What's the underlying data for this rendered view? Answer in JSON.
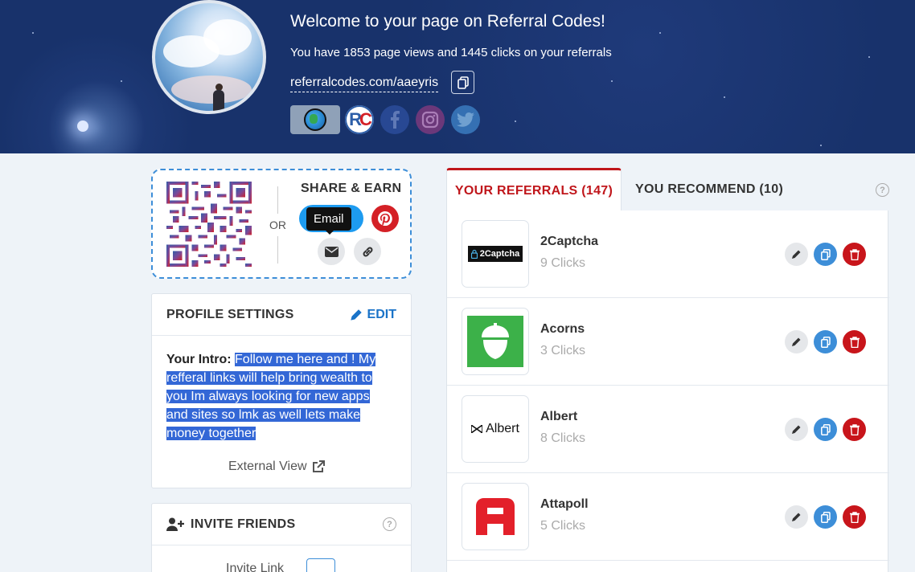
{
  "header": {
    "welcome": "Welcome to your page on Referral Codes!",
    "stats": "You have 1853 page views and 1445 clicks on your referrals",
    "url": "referralcodes.com/aaeyris",
    "socials": [
      "globe-icon",
      "referralcodes-icon",
      "facebook-icon",
      "instagram-icon",
      "twitter-icon"
    ],
    "rc_logo": {
      "r": "R",
      "c": "C"
    }
  },
  "share": {
    "or": "OR",
    "title": "SHARE & EARN",
    "tooltip": "Email"
  },
  "profile": {
    "title": "PROFILE SETTINGS",
    "edit": "EDIT",
    "intro_label": "Your Intro:",
    "intro_text": "Follow me here and ! My refferal links will help bring wealth to you Im always looking for new apps and sites so lmk as well lets make money together",
    "external": "External View"
  },
  "invite": {
    "title": "INVITE FRIENDS",
    "link_label": "Invite Link"
  },
  "tabs": {
    "active": "YOUR REFERRALS (147)",
    "inactive": "YOU RECOMMEND (10)"
  },
  "referrals": [
    {
      "name": "2Captcha",
      "clicks": "9 Clicks",
      "logo_text": "2Captcha"
    },
    {
      "name": "Acorns",
      "clicks": "3 Clicks"
    },
    {
      "name": "Albert",
      "clicks": "8 Clicks",
      "logo_text": "Albert"
    },
    {
      "name": "Attapoll",
      "clicks": "5 Clicks"
    }
  ],
  "colors": {
    "accent_red": "#c0161b",
    "accent_blue": "#3d8ed8",
    "banner": "#1b3574"
  }
}
